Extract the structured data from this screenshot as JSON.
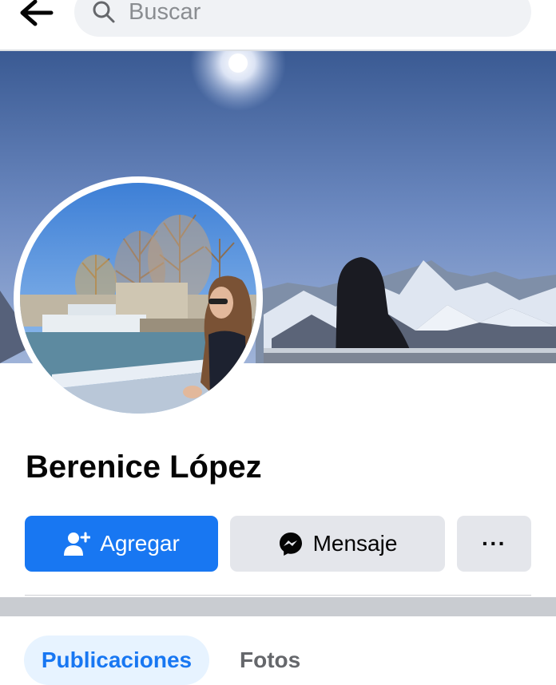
{
  "header": {
    "search_placeholder": "Buscar",
    "back_icon": "arrow-left-icon",
    "search_icon": "search-icon"
  },
  "profile": {
    "name": "Berenice López"
  },
  "actions": {
    "add_label": "Agregar",
    "add_icon": "add-friend-icon",
    "message_label": "Mensaje",
    "message_icon": "messenger-icon",
    "more_label": "···"
  },
  "tabs": [
    {
      "label": "Publicaciones",
      "selected": true
    },
    {
      "label": "Fotos",
      "selected": false
    }
  ],
  "colors": {
    "accent": "#1877f2",
    "secondary_button": "#e4e6eb",
    "search_bg": "#f0f2f5"
  }
}
